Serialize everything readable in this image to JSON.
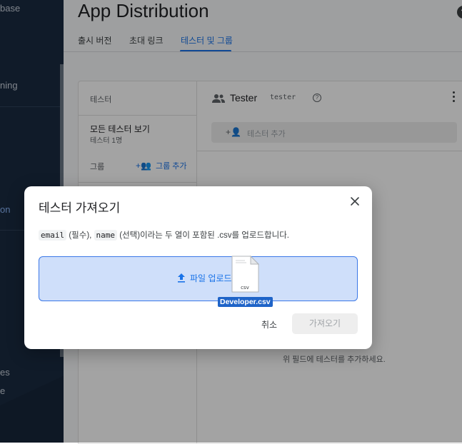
{
  "sidebar": {
    "items": [
      {
        "label": "base"
      },
      {
        "label": "ning"
      },
      {
        "label": "on"
      },
      {
        "label": "es"
      },
      {
        "label": "e"
      }
    ]
  },
  "header": {
    "title": "App Distribution",
    "help_icon": "?"
  },
  "tabs": [
    {
      "label": "출시 버전"
    },
    {
      "label": "초대 링크"
    },
    {
      "label": "테스터 및 그룹",
      "active": true
    }
  ],
  "left_panel": {
    "header": "테스터",
    "all_testers": "모든 테스터 보기",
    "tester_count": "테스터 1명",
    "group_label": "그룹",
    "add_group": "그룹 추가"
  },
  "right_panel": {
    "title": "Tester",
    "alias": "tester",
    "add_placeholder": "테스터 추가",
    "empty_hint": "위 필드에 테스터를 추가하세요."
  },
  "dialog": {
    "title": "테스터 가져오기",
    "desc": {
      "code1": "email",
      "t1": "(필수),",
      "code2": "name",
      "t2": "(선택)이라는 두 열이 포함된 .csv를 업로드합니다."
    },
    "upload_label": "파일 업로드",
    "drag_file_ext": "csv",
    "drag_file_name": "Developer.csv",
    "cancel": "취소",
    "import": "가져오기"
  },
  "icons": {
    "people": "people-icon",
    "help": "help-circle-icon",
    "kebab": "more-vert-icon",
    "add_person": "person-add-icon",
    "upload": "upload-icon",
    "close": "close-icon",
    "file": "csv-file-icon"
  },
  "colors": {
    "accent": "#1a73e8",
    "sidebar": "#1a2b40",
    "dropzone_bg": "#cfdffa",
    "file_label_bg": "#1f64c8"
  }
}
